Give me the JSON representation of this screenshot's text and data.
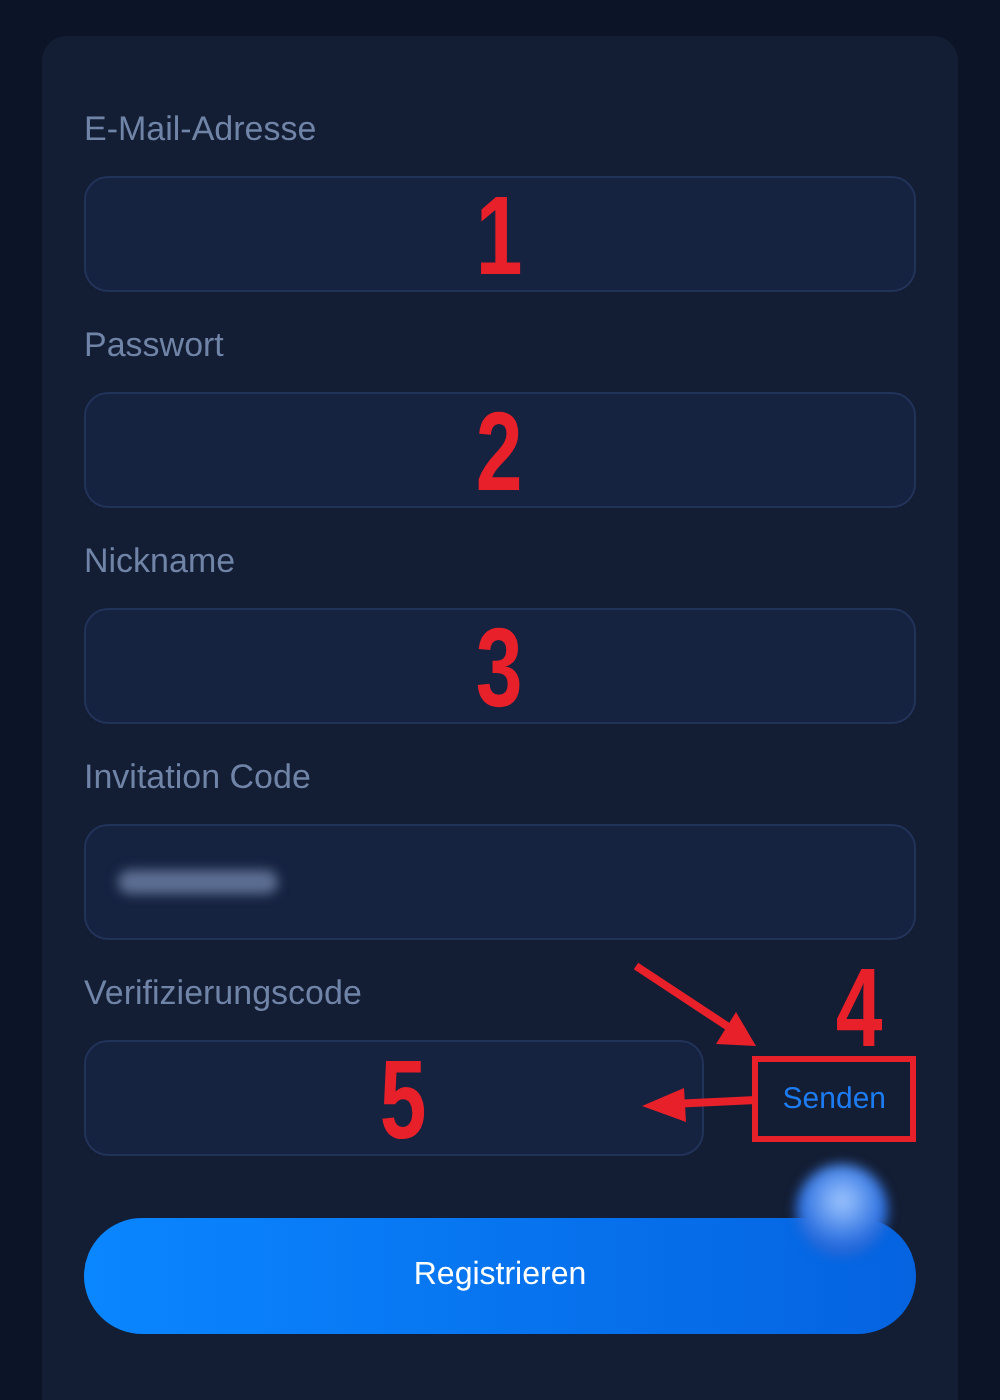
{
  "fields": [
    {
      "kind": "input",
      "label": "E-Mail-Adresse",
      "redacted": false,
      "annotation": "1"
    },
    {
      "kind": "input",
      "label": "Passwort",
      "redacted": false,
      "annotation": "2"
    },
    {
      "kind": "input",
      "label": "Nickname",
      "redacted": false,
      "annotation": "3"
    },
    {
      "kind": "input",
      "label": "Invitation Code",
      "redacted": true
    },
    {
      "kind": "code",
      "label": "Verifizierungscode",
      "redacted": false,
      "annotation": "5",
      "send_button": {
        "label": "Senden",
        "highlighted": true,
        "annotation": "4"
      }
    }
  ],
  "submit_button": {
    "label": "Registrieren"
  }
}
